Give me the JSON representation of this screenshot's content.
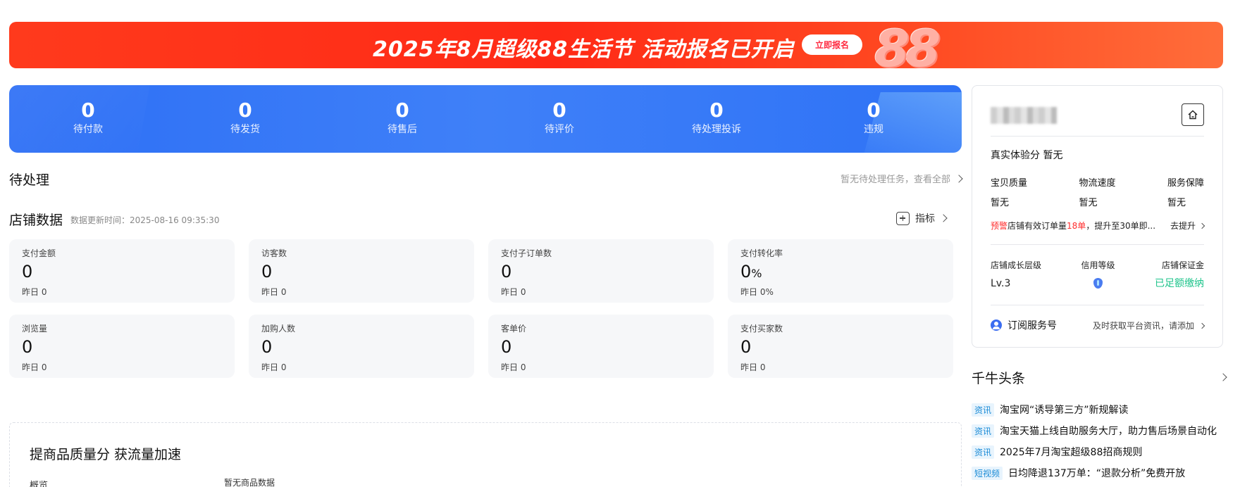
{
  "banner": {
    "title": "2025年8月超级88生活节 活动报名已开启",
    "button": "立即报名",
    "logo_text": "88",
    "gradient_start": "#ff3a1c",
    "gradient_end": "#ff6d3a"
  },
  "status_bar": {
    "background": "#3f80f8",
    "items": [
      {
        "value": "0",
        "label": "待付款"
      },
      {
        "value": "0",
        "label": "待发货"
      },
      {
        "value": "0",
        "label": "待售后"
      },
      {
        "value": "0",
        "label": "待评价"
      },
      {
        "value": "0",
        "label": "待处理投诉"
      },
      {
        "value": "0",
        "label": "违规"
      }
    ]
  },
  "todo": {
    "title": "待处理",
    "link": "暂无待处理任务，查看全部"
  },
  "shop_data": {
    "title": "店铺数据",
    "update_time": "数据更新时间：2025-08-16 09:35:30",
    "indicator_link": "指标",
    "metrics": [
      {
        "label": "支付金额",
        "value": "0",
        "unit": "",
        "yesterday": "昨日 0"
      },
      {
        "label": "访客数",
        "value": "0",
        "unit": "",
        "yesterday": "昨日 0"
      },
      {
        "label": "支付子订单数",
        "value": "0",
        "unit": "",
        "yesterday": "昨日 0"
      },
      {
        "label": "支付转化率",
        "value": "0",
        "unit": "%",
        "yesterday": "昨日 0%"
      },
      {
        "label": "浏览量",
        "value": "0",
        "unit": "",
        "yesterday": "昨日 0"
      },
      {
        "label": "加购人数",
        "value": "0",
        "unit": "",
        "yesterday": "昨日 0"
      },
      {
        "label": "客单价",
        "value": "0",
        "unit": "",
        "yesterday": "昨日 0"
      },
      {
        "label": "支付买家数",
        "value": "0",
        "unit": "",
        "yesterday": "昨日 0"
      }
    ]
  },
  "quality": {
    "title": "提商品质量分 获流量加速",
    "overview": "概览",
    "empty": "暂无商品数据"
  },
  "shop_panel": {
    "home_icon": "home-icon",
    "experience_score": "真实体验分  暂无",
    "dimensions": [
      {
        "label": "宝贝质量",
        "value": "暂无"
      },
      {
        "label": "物流速度",
        "value": "暂无"
      },
      {
        "label": "服务保障",
        "value": "暂无"
      }
    ],
    "warning": {
      "tag": "预警",
      "text_before": "店铺有效订单量",
      "highlight": "18单",
      "text_after": "，提升至30单即...",
      "action": "去提升"
    },
    "levels": {
      "growth_label": "店铺成长层级",
      "growth_value": "Lv.3",
      "credit_label": "信用等级",
      "credit_icon": "credit-level-icon",
      "deposit_label": "店铺保证金",
      "deposit_value": "已足额缴纳",
      "deposit_color": "#1ec48b"
    },
    "subscribe": {
      "label": "订阅服务号",
      "hint": "及时获取平台资讯，请添加"
    }
  },
  "news": {
    "title": "千牛头条",
    "items": [
      {
        "tag": "资讯",
        "text": "淘宝网“诱导第三方”新规解读"
      },
      {
        "tag": "资讯",
        "text": "淘宝天猫上线自助服务大厅，助力售后场景自动化"
      },
      {
        "tag": "资讯",
        "text": "2025年7月淘宝超级88招商规则"
      },
      {
        "tag": "短视频",
        "text": "日均降退137万单：“退款分析”免费开放"
      }
    ]
  }
}
